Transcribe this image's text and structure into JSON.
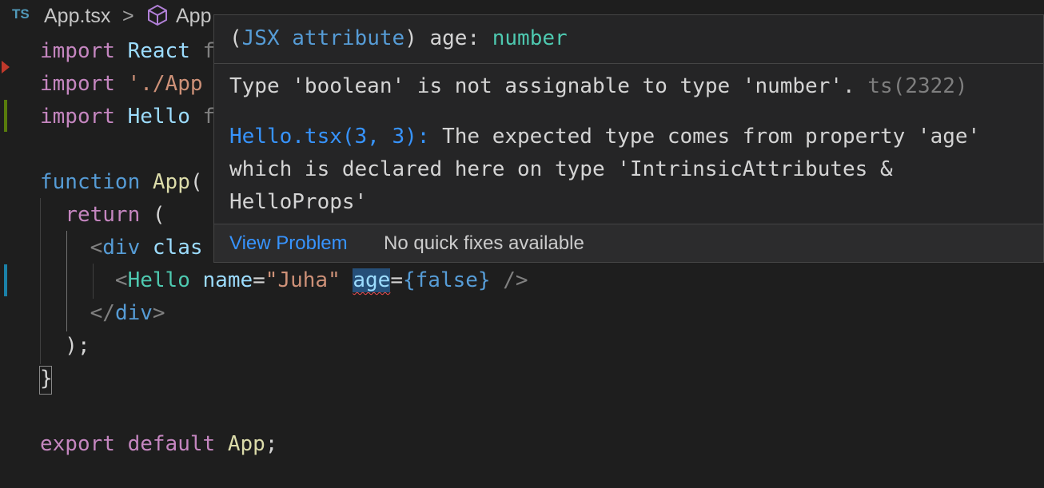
{
  "breadcrumb": {
    "lang_badge": "TS",
    "file": "App.tsx",
    "separator": ">",
    "symbol": "App"
  },
  "code_lines": [
    [
      {
        "t": "import",
        "c": "kw"
      },
      {
        "t": " React ",
        "c": "id"
      },
      {
        "t": "f",
        "c": "pun"
      }
    ],
    [
      {
        "t": "import",
        "c": "kw"
      },
      {
        "t": " ",
        "c": "plain"
      },
      {
        "t": "'./App",
        "c": "str"
      }
    ],
    [
      {
        "t": "import",
        "c": "kw"
      },
      {
        "t": " Hello ",
        "c": "id"
      },
      {
        "t": "f",
        "c": "pun"
      }
    ],
    [
      {
        "t": "",
        "c": "plain"
      }
    ],
    [
      {
        "t": "function",
        "c": "kwb"
      },
      {
        "t": " ",
        "c": "plain"
      },
      {
        "t": "App",
        "c": "fn"
      },
      {
        "t": "(",
        "c": "plain"
      }
    ],
    [
      {
        "t": "  ",
        "c": "plain"
      },
      {
        "t": "return",
        "c": "kw"
      },
      {
        "t": " (",
        "c": "plain"
      }
    ],
    [
      {
        "t": "    ",
        "c": "plain"
      },
      {
        "t": "<",
        "c": "pun"
      },
      {
        "t": "div",
        "c": "htm"
      },
      {
        "t": " clas",
        "c": "id"
      }
    ],
    [
      {
        "t": "      ",
        "c": "plain"
      },
      {
        "t": "<",
        "c": "pun"
      },
      {
        "t": "Hello",
        "c": "tag"
      },
      {
        "t": " name",
        "c": "id"
      },
      {
        "t": "=",
        "c": "plain"
      },
      {
        "t": "\"Juha\"",
        "c": "str"
      },
      {
        "t": " ",
        "c": "plain"
      },
      {
        "t": "age",
        "c": "id squiggle word-highlight"
      },
      {
        "t": "=",
        "c": "plain"
      },
      {
        "t": "{false}",
        "c": "kwb"
      },
      {
        "t": " />",
        "c": "pun"
      }
    ],
    [
      {
        "t": "    ",
        "c": "plain"
      },
      {
        "t": "</",
        "c": "pun"
      },
      {
        "t": "div",
        "c": "htm"
      },
      {
        "t": ">",
        "c": "pun"
      }
    ],
    [
      {
        "t": "  );",
        "c": "plain"
      }
    ],
    [
      {
        "t": "}",
        "c": "plain"
      }
    ],
    [
      {
        "t": "",
        "c": "plain"
      }
    ],
    [
      {
        "t": "export",
        "c": "kw"
      },
      {
        "t": " ",
        "c": "plain"
      },
      {
        "t": "default",
        "c": "kw"
      },
      {
        "t": " ",
        "c": "plain"
      },
      {
        "t": "App",
        "c": "fn"
      },
      {
        "t": ";",
        "c": "plain"
      }
    ]
  ],
  "hover": {
    "sig_open": "(",
    "sig_kind": "JSX attribute",
    "sig_close": ")",
    "sig_name": " age",
    "sig_colon": ": ",
    "sig_type": "number",
    "message": "Type 'boolean' is not assignable to type 'number'. ",
    "error_code": "ts(2322)",
    "related_location": "Hello.tsx(3, 3):",
    "related_text": " The expected type comes from property 'age' which is declared here on type 'IntrinsicAttributes & HelloProps'",
    "action_view_problem": "View Problem",
    "action_no_fixes": "No quick fixes available"
  },
  "colors": {
    "background": "#1e1e1e",
    "hover_bg": "#252526",
    "link": "#3794ff",
    "error_squiggle": "#f14c4c"
  }
}
